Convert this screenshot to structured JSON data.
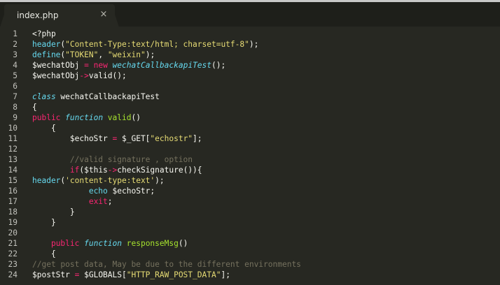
{
  "tab": {
    "title": "index.php",
    "close_glyph": "×"
  },
  "lines": [
    {
      "n": "1",
      "tokens": [
        {
          "t": "<?php",
          "c": "var"
        }
      ]
    },
    {
      "n": "2",
      "tokens": [
        {
          "t": "header",
          "c": "fn"
        },
        {
          "t": "(",
          "c": "var"
        },
        {
          "t": "\"Content-Type:text/html; charset=utf-8\"",
          "c": "str"
        },
        {
          "t": ");",
          "c": "var"
        }
      ]
    },
    {
      "n": "3",
      "tokens": [
        {
          "t": "define",
          "c": "fn"
        },
        {
          "t": "(",
          "c": "var"
        },
        {
          "t": "\"TOKEN\"",
          "c": "str"
        },
        {
          "t": ", ",
          "c": "var"
        },
        {
          "t": "\"weixin\"",
          "c": "str"
        },
        {
          "t": ");",
          "c": "var"
        }
      ]
    },
    {
      "n": "4",
      "tokens": [
        {
          "t": "$wechatObj ",
          "c": "var"
        },
        {
          "t": "=",
          "c": "kw"
        },
        {
          "t": " ",
          "c": "var"
        },
        {
          "t": "new",
          "c": "kw"
        },
        {
          "t": " ",
          "c": "var"
        },
        {
          "t": "wechatCallbackapiTest",
          "c": "fn it"
        },
        {
          "t": "();",
          "c": "var"
        }
      ]
    },
    {
      "n": "5",
      "tokens": [
        {
          "t": "$wechatObj",
          "c": "var"
        },
        {
          "t": "->",
          "c": "kw"
        },
        {
          "t": "valid();",
          "c": "var"
        }
      ]
    },
    {
      "n": "6",
      "tokens": []
    },
    {
      "n": "7",
      "tokens": [
        {
          "t": "class",
          "c": "fn it"
        },
        {
          "t": " wechatCallbackapiTest",
          "c": "var"
        }
      ]
    },
    {
      "n": "8",
      "tokens": [
        {
          "t": "{",
          "c": "var"
        }
      ]
    },
    {
      "n": "9",
      "tokens": [
        {
          "t": "public",
          "c": "kw"
        },
        {
          "t": " ",
          "c": "var"
        },
        {
          "t": "function",
          "c": "fn it"
        },
        {
          "t": " valid",
          "c": "cls"
        },
        {
          "t": "()",
          "c": "var"
        }
      ]
    },
    {
      "n": "10",
      "tokens": [
        {
          "t": "    {",
          "c": "var"
        }
      ]
    },
    {
      "n": "11",
      "tokens": [
        {
          "t": "        $echoStr ",
          "c": "var"
        },
        {
          "t": "=",
          "c": "kw"
        },
        {
          "t": " $_GET[",
          "c": "var"
        },
        {
          "t": "\"echostr\"",
          "c": "str"
        },
        {
          "t": "];",
          "c": "var"
        }
      ]
    },
    {
      "n": "12",
      "tokens": []
    },
    {
      "n": "13",
      "tokens": [
        {
          "t": "        //valid signature , option",
          "c": "cmt"
        }
      ]
    },
    {
      "n": "14",
      "tokens": [
        {
          "t": "        ",
          "c": "var"
        },
        {
          "t": "if",
          "c": "kw"
        },
        {
          "t": "($this",
          "c": "var"
        },
        {
          "t": "->",
          "c": "kw"
        },
        {
          "t": "checkSignature()){",
          "c": "var"
        }
      ]
    },
    {
      "n": "15",
      "tokens": [
        {
          "t": "header",
          "c": "fn"
        },
        {
          "t": "(",
          "c": "var"
        },
        {
          "t": "'content-type:text'",
          "c": "str"
        },
        {
          "t": ");",
          "c": "var"
        }
      ]
    },
    {
      "n": "16",
      "tokens": [
        {
          "t": "            ",
          "c": "var"
        },
        {
          "t": "echo",
          "c": "fn"
        },
        {
          "t": " $echoStr;",
          "c": "var"
        }
      ]
    },
    {
      "n": "17",
      "tokens": [
        {
          "t": "            ",
          "c": "var"
        },
        {
          "t": "exit",
          "c": "kw"
        },
        {
          "t": ";",
          "c": "var"
        }
      ]
    },
    {
      "n": "18",
      "tokens": [
        {
          "t": "        }",
          "c": "var"
        }
      ]
    },
    {
      "n": "19",
      "tokens": [
        {
          "t": "    }",
          "c": "var"
        }
      ]
    },
    {
      "n": "20",
      "tokens": []
    },
    {
      "n": "21",
      "tokens": [
        {
          "t": "    ",
          "c": "var"
        },
        {
          "t": "public",
          "c": "kw"
        },
        {
          "t": " ",
          "c": "var"
        },
        {
          "t": "function",
          "c": "fn it"
        },
        {
          "t": " responseMsg",
          "c": "cls"
        },
        {
          "t": "()",
          "c": "var"
        }
      ]
    },
    {
      "n": "22",
      "tokens": [
        {
          "t": "    {",
          "c": "var"
        }
      ]
    },
    {
      "n": "23",
      "tokens": [
        {
          "t": "//get post data, May be due to the different environments",
          "c": "cmt"
        }
      ]
    },
    {
      "n": "24",
      "tokens": [
        {
          "t": "$postStr ",
          "c": "var"
        },
        {
          "t": "=",
          "c": "kw"
        },
        {
          "t": " $GLOBALS[",
          "c": "var"
        },
        {
          "t": "\"HTTP_RAW_POST_DATA\"",
          "c": "str"
        },
        {
          "t": "];",
          "c": "var"
        }
      ]
    }
  ]
}
